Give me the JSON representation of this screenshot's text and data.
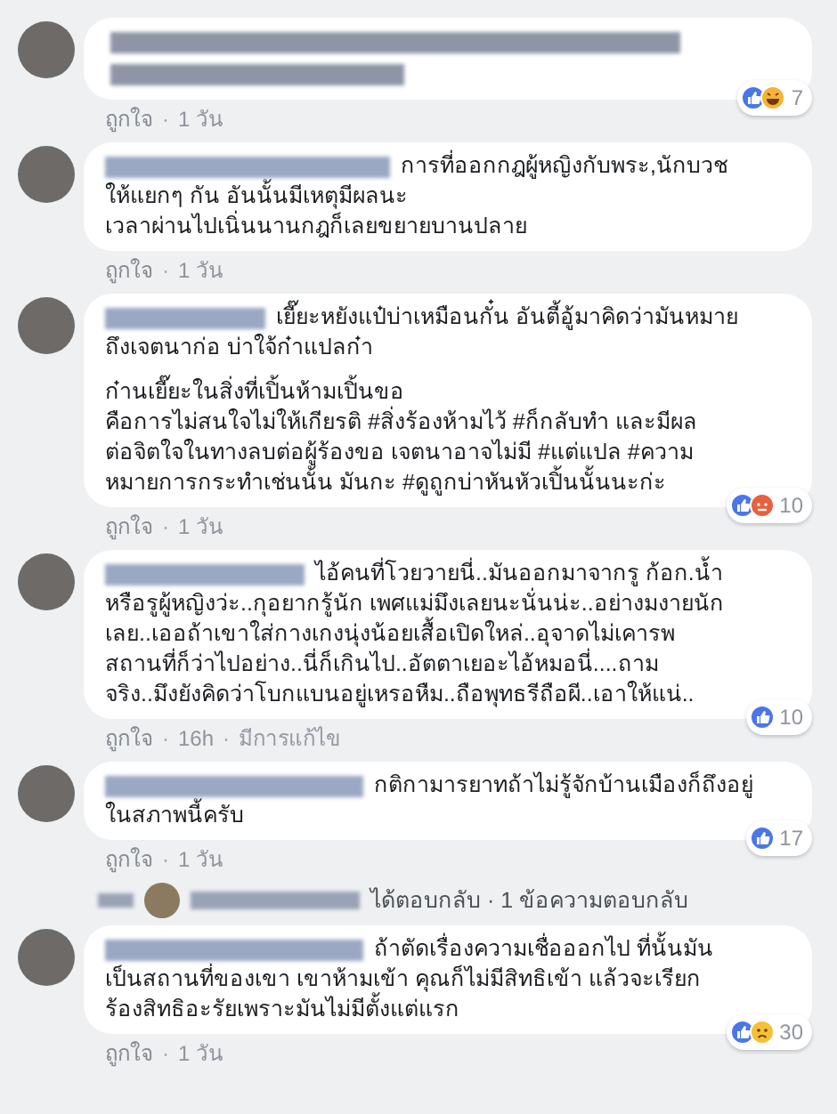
{
  "comments": [
    {
      "text_blurred": true,
      "actions": [
        {
          "kind": "link",
          "text": "ถูกใจ"
        },
        {
          "kind": "separator",
          "text": "·"
        },
        {
          "kind": "time",
          "text": "1 วัน"
        }
      ],
      "reactions": {
        "icons": [
          {
            "kind": "like"
          },
          {
            "kind": "haha"
          }
        ],
        "count": "7"
      }
    },
    {
      "name_blurred": true,
      "text_blurred": false,
      "paragraphs": [
        "การที่ออกกฎผู้หญิงกับพระ,นักบวช\nให้แยกๆ กัน อันนั้นมีเหตุมีผลนะ\nเวลาผ่านไปเนิ่นนานกฎก็เลยขยายบานปลาย"
      ],
      "actions": [
        {
          "kind": "link",
          "text": "ถูกใจ"
        },
        {
          "kind": "separator",
          "text": "·"
        },
        {
          "kind": "time",
          "text": "1 วัน"
        }
      ]
    },
    {
      "name_blurred": true,
      "text_blurred": false,
      "paragraphs": [
        "เยี๊ยะหยังแป๋บ่าเหมือนกั๋น อันตี้อู้มาคิดว่ามันหมาย\nถึงเจตนาก่อ บ่าใจ้ก๋าแปลก๋า",
        "ก๋านเยี๊ยะในสิ่งที่เปิ้นห้ามเปิ้นขอ\nคือการไม่สนใจไม่ให้เกียรติ #สิ่งร้องห้ามไว้ #ก็กลับทำ และมีผล\nต่อจิตใจในทางลบต่อผู้ร้องขอ เจตนาอาจไม่มี #แต่แปล #ความ\nหมายการกระทำเช่นนั้น มันกะ #ดูถูกบ่าหันหัวเปิ้นนั้นนะก่ะ"
      ],
      "actions": [
        {
          "kind": "link",
          "text": "ถูกใจ"
        },
        {
          "kind": "separator",
          "text": "·"
        },
        {
          "kind": "time",
          "text": "1 วัน"
        }
      ],
      "reactions": {
        "icons": [
          {
            "kind": "like"
          },
          {
            "kind": "angry"
          }
        ],
        "count": "10"
      }
    },
    {
      "name_blurred": true,
      "text_blurred": false,
      "paragraphs": [
        "ไอ้คนที่โวยวายนี่..มันออกมาจากรู ก้อก.น้ำ\nหรือรูผู้หญิงว่ะ..กุอยากรู้นัก เพศแม่มึงเลยนะนั่นน่ะ..อย่างมงายนัก\nเลย..เออถ้าเขาใส่กางเกงนุ่งน้อยเสื้อเปิดใหล่..อุจาดไม่เคารพ\nสถานที่ก็ว่าไปอย่าง..นี่ก็เกินไป..อัตตาเยอะไอ้หมอนี่....ถาม\nจริง..มึงยังคิดว่าโบกแบนอยู่เหรอหืม..ถือพุทธรีถือผี..เอาให้แน่.."
      ],
      "actions": [
        {
          "kind": "link",
          "text": "ถูกใจ"
        },
        {
          "kind": "separator",
          "text": "·"
        },
        {
          "kind": "time",
          "text": "16h"
        },
        {
          "kind": "separator",
          "text": "·"
        },
        {
          "kind": "edited",
          "text": "มีการแก้ไข"
        }
      ],
      "reactions": {
        "icons": [
          {
            "kind": "like"
          }
        ],
        "count": "10"
      }
    },
    {
      "name_blurred": true,
      "text_blurred": false,
      "paragraphs": [
        "กติกามารยาทถ้าไม่รู้จักบ้านเมืองก็ถึงอยู่\nในสภาพนี้ครับ"
      ],
      "actions": [
        {
          "kind": "link",
          "text": "ถูกใจ"
        },
        {
          "kind": "separator",
          "text": "·"
        },
        {
          "kind": "time",
          "text": "1 วัน"
        }
      ],
      "reactions": {
        "icons": [
          {
            "kind": "like"
          }
        ],
        "count": "17"
      },
      "replies": {
        "text": "ได้ตอบกลับ · 1 ข้อความตอบกลับ"
      }
    },
    {
      "name_blurred": true,
      "text_blurred": false,
      "paragraphs": [
        "ถ้าตัดเรื่องความเชื่อออกไป ที่นั้นมัน\nเป็นสถานที่ของเขา เขาห้ามเข้า คุณก็ไม่มีสิทธิเข้า แล้วจะเรียก\nร้องสิทธิอะรัยเพราะมันไม่มีตั้งแต่แรก"
      ],
      "actions": [
        {
          "kind": "link",
          "text": "ถูกใจ"
        },
        {
          "kind": "separator",
          "text": "·"
        },
        {
          "kind": "time",
          "text": "1 วัน"
        }
      ],
      "reactions": {
        "icons": [
          {
            "kind": "like"
          },
          {
            "kind": "sad"
          }
        ],
        "count": "30"
      }
    }
  ]
}
